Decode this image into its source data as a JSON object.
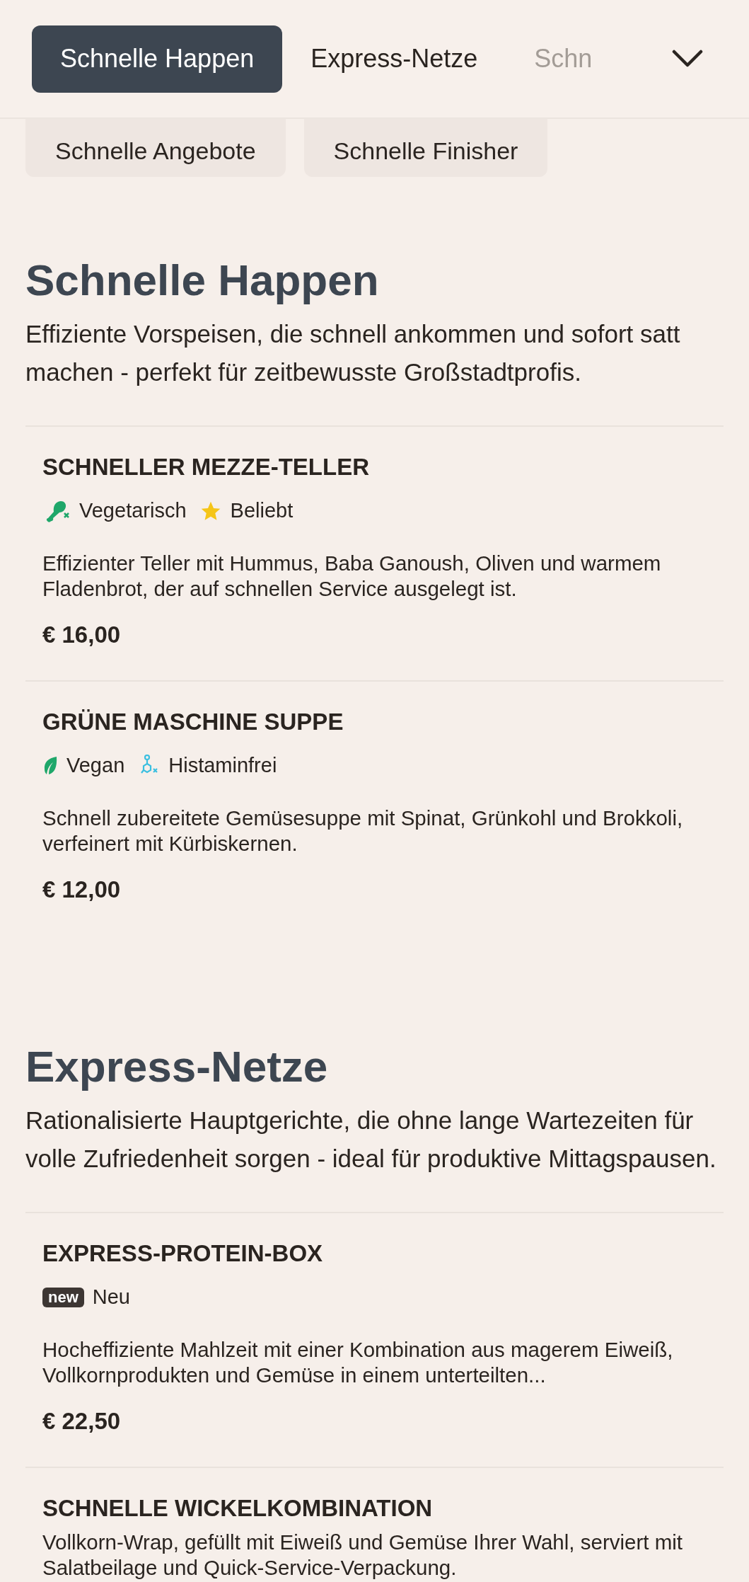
{
  "nav": {
    "tabs": [
      {
        "label": "Schnelle Happen",
        "selected": true,
        "faded": false
      },
      {
        "label": "Express-Netze",
        "selected": false,
        "faded": false
      },
      {
        "label": "Schn",
        "selected": false,
        "faded": true
      }
    ],
    "subtabs": [
      {
        "label": "Schnelle Angebote",
        "selected": false
      },
      {
        "label": "Schnelle Finisher",
        "selected": false
      }
    ]
  },
  "sections": [
    {
      "title": "Schnelle Happen",
      "description": "Effiziente Vorspeisen, die schnell ankommen und sofort satt machen - perfekt für zeitbewusste Großstadtprofis.",
      "items": [
        {
          "name": "SCHNELLER MEZZE-TELLER",
          "tags": [
            {
              "kind": "vegetarian",
              "label": "Vegetarisch"
            },
            {
              "kind": "popular",
              "label": "Beliebt"
            }
          ],
          "description": "Effizienter Teller mit Hummus, Baba Ganoush, Oliven und warmem Fladenbrot, der auf schnellen Service ausgelegt ist.",
          "price": "€ 16,00"
        },
        {
          "name": "GRÜNE MASCHINE SUPPE",
          "tags": [
            {
              "kind": "vegan",
              "label": "Vegan"
            },
            {
              "kind": "histamine-free",
              "label": "Histaminfrei"
            }
          ],
          "description": "Schnell zubereitete Gemüsesuppe mit Spinat, Grünkohl und Brokkoli, verfeinert mit Kürbiskernen.",
          "price": "€ 12,00"
        }
      ]
    },
    {
      "title": "Express-Netze",
      "description": "Rationalisierte Hauptgerichte, die ohne lange Wartezeiten für volle Zufriedenheit sorgen - ideal für produktive Mittagspausen.",
      "items": [
        {
          "name": "EXPRESS-PROTEIN-BOX",
          "tags": [
            {
              "kind": "new",
              "badge": "new",
              "label": "Neu"
            }
          ],
          "description": "Hocheffiziente Mahlzeit mit einer Kombination aus magerem Eiweiß, Vollkornprodukten und Gemüse in einem unterteilten...",
          "price": "€ 22,50"
        },
        {
          "name": "SCHNELLE WICKELKOMBINATION",
          "description": "Vollkorn-Wrap, gefüllt mit Eiweiß und Gemüse Ihrer Wahl, serviert mit Salatbeilage und Quick-Service-Verpackung."
        }
      ]
    }
  ]
}
